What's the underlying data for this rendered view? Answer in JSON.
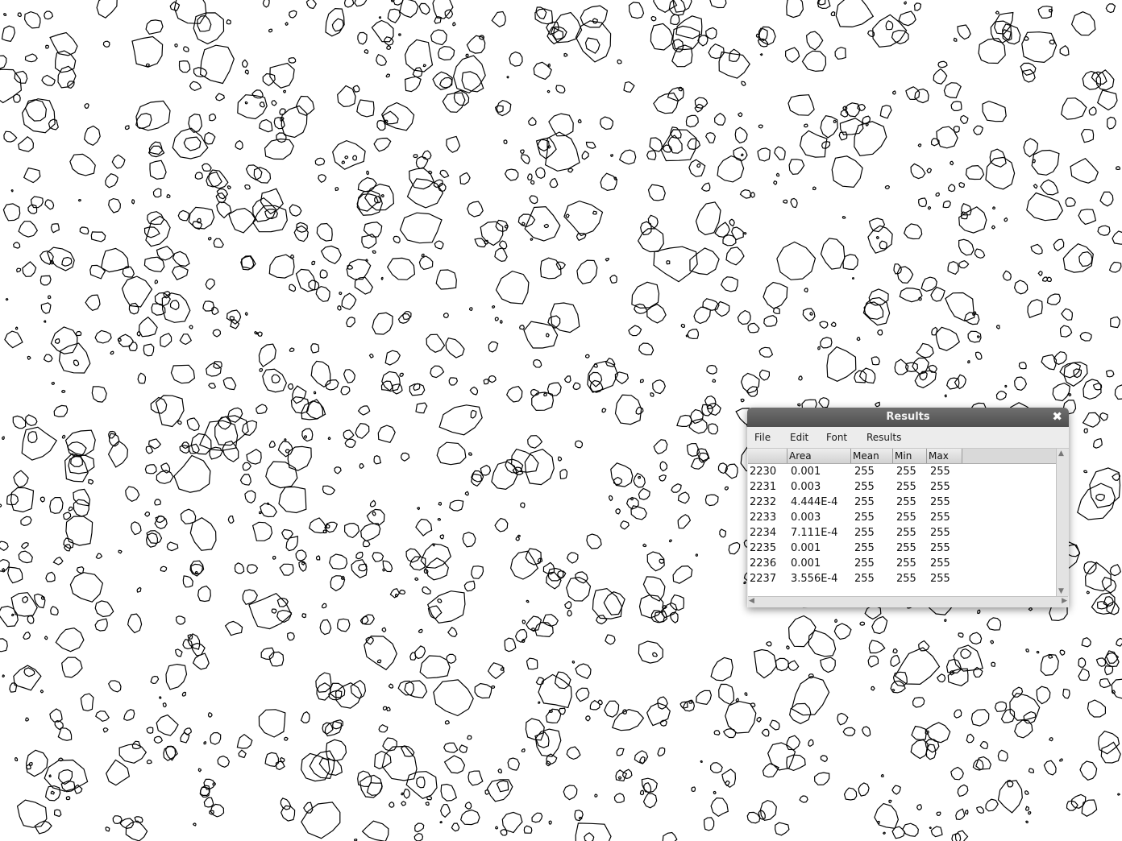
{
  "image": {
    "description_icon": "binary-outline-image"
  },
  "results_window": {
    "title": "Results",
    "close_icon": "close-icon",
    "menu": [
      "File",
      "Edit",
      "Font",
      "Results"
    ],
    "columns": [
      "",
      "Area",
      "Mean",
      "Min",
      "Max"
    ],
    "rows": [
      [
        "2230",
        "0.001",
        "255",
        "255",
        "255"
      ],
      [
        "2231",
        "0.003",
        "255",
        "255",
        "255"
      ],
      [
        "2232",
        "4.444E-4",
        "255",
        "255",
        "255"
      ],
      [
        "2233",
        "0.003",
        "255",
        "255",
        "255"
      ],
      [
        "2234",
        "7.111E-4",
        "255",
        "255",
        "255"
      ],
      [
        "2235",
        "0.001",
        "255",
        "255",
        "255"
      ],
      [
        "2236",
        "0.001",
        "255",
        "255",
        "255"
      ],
      [
        "2237",
        "3.556E-4",
        "255",
        "255",
        "255"
      ]
    ]
  }
}
